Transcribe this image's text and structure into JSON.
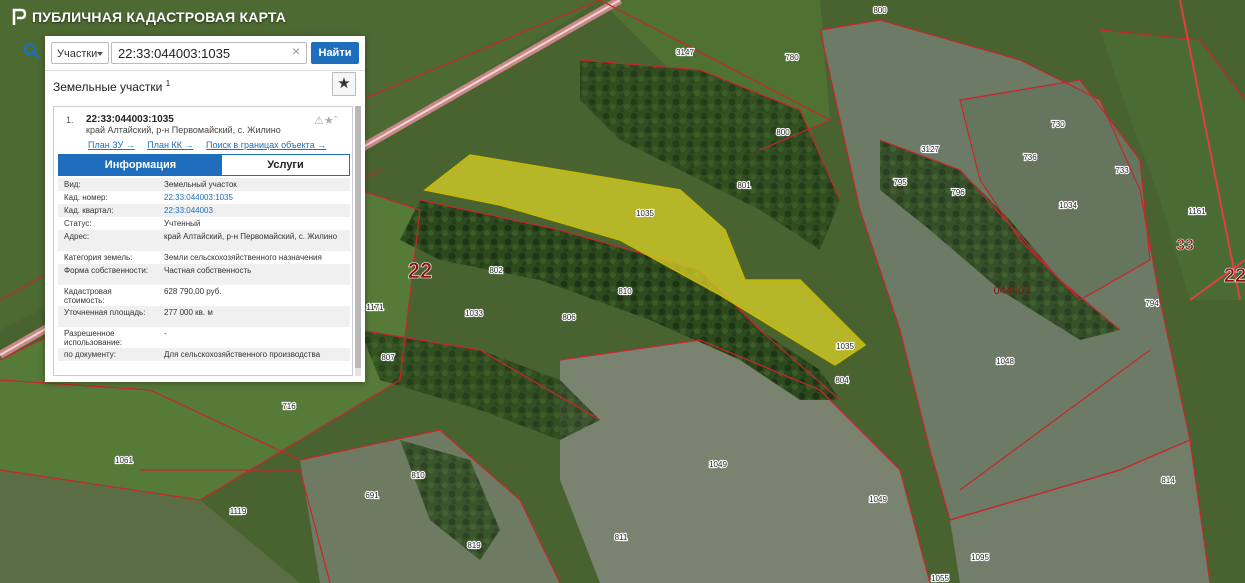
{
  "app": {
    "title": "ПУБЛИЧНАЯ КАДАСТРОВАЯ КАРТА"
  },
  "search": {
    "type_selected": "Участки",
    "value": "22:33:044003:1035",
    "button_label": "Найти"
  },
  "section": {
    "title": "Земельные участки",
    "count": "1"
  },
  "result": {
    "number": "1.",
    "cadastral_number": "22:33:044003:1035",
    "address": "край Алтайский, р-н Первомайский, с. Жилино",
    "links": [
      "План ЗУ →",
      "План КК →",
      "Поиск в границах объекта →"
    ],
    "tabs": [
      "Информация",
      "Услуги"
    ],
    "properties": [
      {
        "label": "Вид:",
        "value": "Земельный участок"
      },
      {
        "label": "Кад. номер:",
        "value": "22:33:044003:1035"
      },
      {
        "label": "Кад. квартал:",
        "value": "22:33:044003"
      },
      {
        "label": "Статус:",
        "value": "Учтенный"
      },
      {
        "label": "Адрес:",
        "value": "край Алтайский, р-н Первомайский, с. Жилино"
      },
      {
        "label": "Категория земель:",
        "value": "Земли сельскохозяйственного назначения"
      },
      {
        "label": "Форма собственности:",
        "value": "Частная собственность"
      },
      {
        "label": "Кадастровая стоимость:",
        "value": "628 790,00 руб."
      },
      {
        "label": "Уточненная площадь:",
        "value": "277 000 кв. м"
      },
      {
        "label": "Разрешенное использование:",
        "value": "-"
      },
      {
        "label": "по документу:",
        "value": "Для сельскохозяйственного производства"
      }
    ]
  },
  "map": {
    "colors": {
      "boundary": "#c8252c",
      "selected_fill": "#d9d227",
      "road": "#d98b8b"
    },
    "district_labels": [
      "22",
      "33",
      "22"
    ],
    "quarter_label": "044003",
    "parcel_labels": [
      "800",
      "3147",
      "780",
      "736",
      "730",
      "733",
      "1034",
      "1161",
      "3127",
      "795",
      "796",
      "800",
      "801",
      "1035",
      "1035",
      "802",
      "810",
      "1033",
      "806",
      "1171",
      "807",
      "716",
      "1061",
      "1049",
      "1049",
      "1048",
      "794",
      "814",
      "810",
      "1119",
      "691",
      "819",
      "811",
      "1095",
      "1055",
      "804"
    ]
  }
}
